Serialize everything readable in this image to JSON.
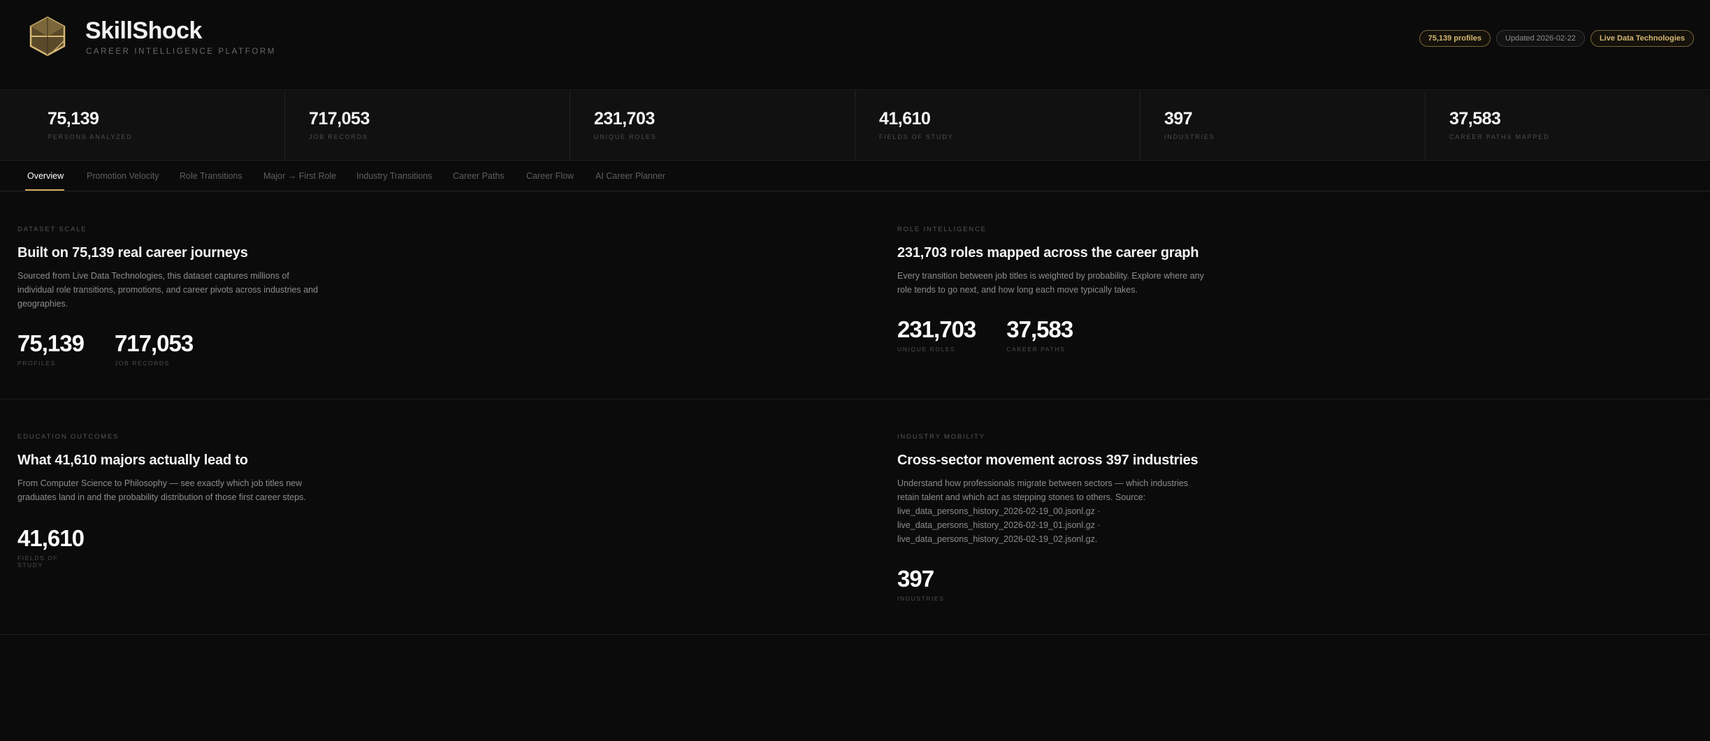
{
  "brand": {
    "title": "SkillShock",
    "subtitle": "CAREER INTELLIGENCE PLATFORM",
    "accent_color": "#d2ab62"
  },
  "badges": [
    {
      "label": "75,139 profiles"
    },
    {
      "label": "Updated 2026-02-22"
    },
    {
      "label": "Live Data Technologies"
    }
  ],
  "stats": [
    {
      "value": "75,139",
      "label": "PERSONS ANALYZED"
    },
    {
      "value": "717,053",
      "label": "JOB RECORDS"
    },
    {
      "value": "231,703",
      "label": "UNIQUE ROLES"
    },
    {
      "value": "41,610",
      "label": "FIELDS OF STUDY"
    },
    {
      "value": "397",
      "label": "INDUSTRIES"
    },
    {
      "value": "37,583",
      "label": "CAREER PATHS MAPPED"
    }
  ],
  "tabs": [
    {
      "label": "Overview",
      "active": true
    },
    {
      "label": "Promotion Velocity"
    },
    {
      "label": "Role Transitions"
    },
    {
      "label": "Major → First Role"
    },
    {
      "label": "Industry Transitions"
    },
    {
      "label": "Career Paths"
    },
    {
      "label": "Career Flow"
    },
    {
      "label": "AI Career Planner"
    }
  ],
  "cards": {
    "dataset": {
      "eyebrow": "DATASET SCALE",
      "title": "Built on 75,139 real career journeys",
      "description": "Sourced from Live Data Technologies, this dataset captures millions of individual role transitions, promotions, and career pivots across industries and geographies.",
      "metrics": [
        {
          "value": "75,139",
          "label": "PROFILES"
        },
        {
          "value": "717,053",
          "label": "JOB RECORDS"
        }
      ]
    },
    "roles": {
      "eyebrow": "ROLE INTELLIGENCE",
      "title": "231,703 roles mapped across the career graph",
      "description": "Every transition between job titles is weighted by probability. Explore where any role tends to go next, and how long each move typically takes.",
      "metrics": [
        {
          "value": "231,703",
          "label": "UNIQUE ROLES"
        },
        {
          "value": "37,583",
          "label": "CAREER PATHS"
        }
      ]
    },
    "education": {
      "eyebrow": "EDUCATION OUTCOMES",
      "title": "What 41,610 majors actually lead to",
      "description": "From Computer Science to Philosophy — see exactly which job titles new graduates land in and the probability distribution of those first career steps.",
      "metrics": [
        {
          "value": "41,610",
          "label": "FIELDS OF STUDY"
        }
      ]
    },
    "industry": {
      "eyebrow": "INDUSTRY MOBILITY",
      "title": "Cross-sector movement across 397 industries",
      "description": "Understand how professionals migrate between sectors — which industries retain talent and which act as stepping stones to others. Source: live_data_persons_history_2026-02-19_00.jsonl.gz · live_data_persons_history_2026-02-19_01.jsonl.gz · live_data_persons_history_2026-02-19_02.jsonl.gz.",
      "metrics": [
        {
          "value": "397",
          "label": "INDUSTRIES"
        }
      ]
    }
  }
}
